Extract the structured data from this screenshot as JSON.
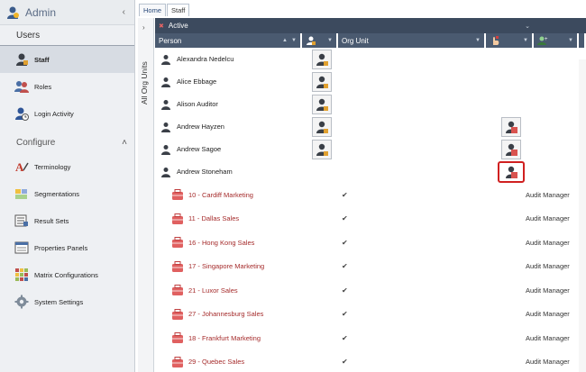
{
  "sidebar": {
    "app_title": "Admin",
    "collapse_glyph": "‹",
    "users_heading": "Users",
    "users_items": [
      {
        "label": "Staff",
        "icon": "staff-icon",
        "active": true
      },
      {
        "label": "Roles",
        "icon": "roles-icon",
        "active": false
      },
      {
        "label": "Login Activity",
        "icon": "login-activity-icon",
        "active": false
      }
    ],
    "configure_heading": "Configure",
    "configure_caret": "˄",
    "configure_items": [
      {
        "label": "Terminology",
        "icon": "terminology-icon"
      },
      {
        "label": "Segmentations",
        "icon": "segmentations-icon"
      },
      {
        "label": "Result Sets",
        "icon": "result-sets-icon"
      },
      {
        "label": "Properties Panels",
        "icon": "properties-panels-icon"
      },
      {
        "label": "Matrix Configurations",
        "icon": "matrix-configurations-icon"
      },
      {
        "label": "System Settings",
        "icon": "system-settings-icon"
      }
    ]
  },
  "tabs": [
    {
      "label": "Home",
      "active": false
    },
    {
      "label": "Staff",
      "active": true
    }
  ],
  "side_strip": {
    "label": "All Org Units",
    "chevron": "›"
  },
  "filter_bar": {
    "label": "Active",
    "remove_glyph": "✖",
    "dropdown_glyph": "⌄"
  },
  "columns": {
    "person": "Person",
    "org_unit": "Org Unit"
  },
  "people": [
    {
      "name": "Alexandra Nedelcu",
      "badge_col1": true,
      "badge_col2": false
    },
    {
      "name": "Alice Ebbage",
      "badge_col1": true,
      "badge_col2": false
    },
    {
      "name": "Alison Auditor",
      "badge_col1": true,
      "badge_col2": false
    },
    {
      "name": "Andrew Hayzen",
      "badge_col1": true,
      "badge_col2": true
    },
    {
      "name": "Andrew Sagoe",
      "badge_col1": true,
      "badge_col2": true
    },
    {
      "name": "Andrew Stoneham",
      "badge_col1": false,
      "badge_col2": true,
      "highlighted": true
    }
  ],
  "org_units": [
    {
      "name": "10 - Cardiff Marketing",
      "check": "✔",
      "role": "Audit Manager"
    },
    {
      "name": "11 - Dallas Sales",
      "check": "✔",
      "role": "Audit Manager"
    },
    {
      "name": "16 - Hong Kong Sales",
      "check": "✔",
      "role": "Audit Manager"
    },
    {
      "name": "17 - Singapore Marketing",
      "check": "✔",
      "role": "Audit Manager"
    },
    {
      "name": "21 - Luxor Sales",
      "check": "✔",
      "role": "Audit Manager"
    },
    {
      "name": "27 - Johannesburg Sales",
      "check": "✔",
      "role": "Audit Manager"
    },
    {
      "name": "18 - Frankfurt Marketing",
      "check": "✔",
      "role": "Audit Manager"
    },
    {
      "name": "29 - Quebec Sales",
      "check": "✔",
      "role": "Audit Manager"
    }
  ],
  "colors": {
    "header_dark": "#3c4a5e",
    "column_header": "#4a5a70",
    "org_unit_text": "#a52b2b",
    "highlight_outline": "#d02020"
  }
}
